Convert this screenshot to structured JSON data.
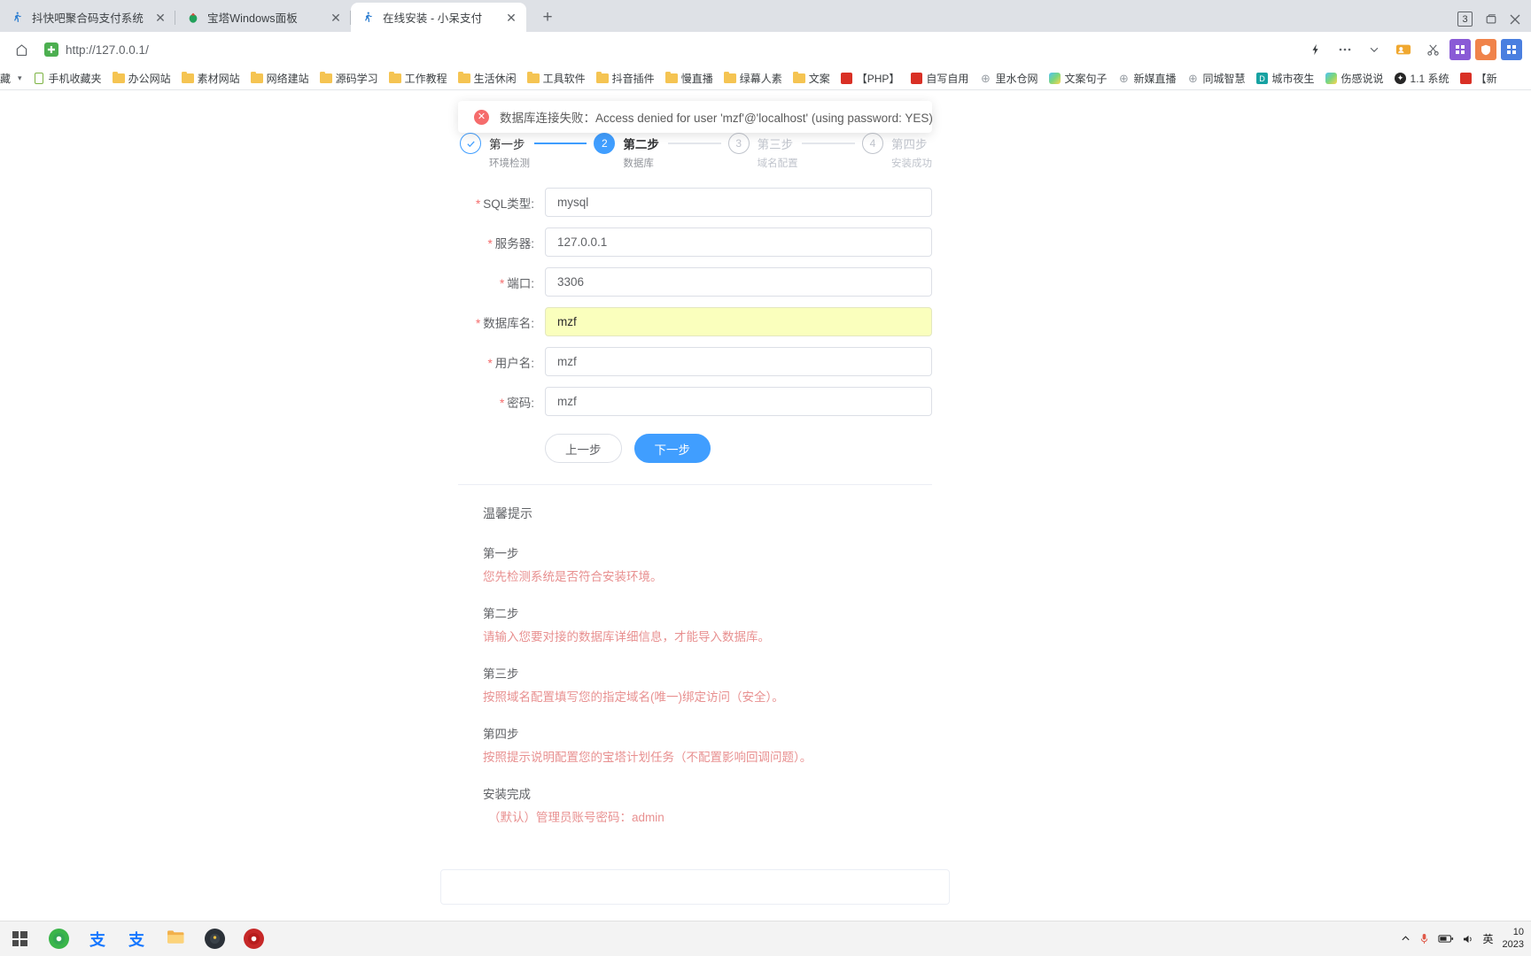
{
  "browser": {
    "tabs": [
      {
        "title": "抖快吧聚合码支付系统",
        "favicon": "runner-icon",
        "active": false
      },
      {
        "title": "宝塔Windows面板",
        "favicon": "bt-panel-icon",
        "active": false
      },
      {
        "title": "在线安装 - 小呆支付",
        "favicon": "runner-icon",
        "active": true
      }
    ],
    "new_tab_label": "+",
    "close_label": "✕",
    "window_controls": {
      "tab_count": "3",
      "restore": "restore-icon",
      "close": "close-icon"
    },
    "toolbar": {
      "home_icon": "home-icon",
      "url": "http://127.0.0.1/",
      "secure_badge": "shield-icon",
      "icons": [
        "lightning-icon",
        "more-horizontal-icon",
        "chevron-down-icon",
        "user-badge-icon",
        "scissors-icon",
        "grid-purple-icon",
        "shield-orange-icon",
        "apps-blue-icon"
      ]
    },
    "bookmarks_overflow_label": "藏",
    "bookmarks": [
      {
        "label": "手机收藏夹",
        "icon": "phone-icon"
      },
      {
        "label": "办公网站",
        "icon": "folder-icon"
      },
      {
        "label": "素材网站",
        "icon": "folder-icon"
      },
      {
        "label": "网络建站",
        "icon": "folder-icon"
      },
      {
        "label": "源码学习",
        "icon": "folder-icon"
      },
      {
        "label": "工作教程",
        "icon": "folder-icon"
      },
      {
        "label": "生活休闲",
        "icon": "folder-icon"
      },
      {
        "label": "工具软件",
        "icon": "folder-icon"
      },
      {
        "label": "抖音插件",
        "icon": "folder-icon"
      },
      {
        "label": "慢直播",
        "icon": "folder-icon"
      },
      {
        "label": "绿幕人素",
        "icon": "folder-icon"
      },
      {
        "label": "文案",
        "icon": "folder-icon"
      },
      {
        "label": "【PHP】",
        "icon": "red-square-icon"
      },
      {
        "label": "自写自用",
        "icon": "red-square-icon"
      },
      {
        "label": "里水仓网",
        "icon": "globe-icon"
      },
      {
        "label": "文案句子",
        "icon": "gradient-icon"
      },
      {
        "label": "新媒直播",
        "icon": "globe-icon"
      },
      {
        "label": "同城智慧",
        "icon": "globe-icon"
      },
      {
        "label": "城市夜生",
        "icon": "teal-square-icon"
      },
      {
        "label": "伤感说说",
        "icon": "gradient-icon"
      },
      {
        "label": "1.1 系统",
        "icon": "black-circle-icon"
      },
      {
        "label": "【新",
        "icon": "red-square-icon"
      }
    ]
  },
  "page": {
    "alert": {
      "icon": "error-circle-icon",
      "message": "数据库连接失败：Access denied for user 'mzf'@'localhost' (using password: YES)"
    },
    "steps": [
      {
        "number": "✓",
        "title": "第一步",
        "sub": "环境检测",
        "state": "done"
      },
      {
        "number": "2",
        "title": "第二步",
        "sub": "数据库",
        "state": "current"
      },
      {
        "number": "3",
        "title": "第三步",
        "sub": "域名配置",
        "state": "todo"
      },
      {
        "number": "4",
        "title": "第四步",
        "sub": "安装成功",
        "state": "todo"
      }
    ],
    "form": {
      "required_mark": "*",
      "fields": [
        {
          "label": "SQL类型:",
          "value": "mysql",
          "autofill": false
        },
        {
          "label": "服务器:",
          "value": "127.0.0.1",
          "autofill": false
        },
        {
          "label": "端口:",
          "value": "3306",
          "autofill": false
        },
        {
          "label": "数据库名:",
          "value": "mzf",
          "autofill": true
        },
        {
          "label": "用户名:",
          "value": "mzf",
          "autofill": false
        },
        {
          "label": "密码:",
          "value": "mzf",
          "autofill": false
        }
      ],
      "prev_button": "上一步",
      "next_button": "下一步"
    },
    "tips": {
      "title": "温馨提示",
      "items": [
        {
          "heading": "第一步",
          "body": "您先检测系统是否符合安装环境。"
        },
        {
          "heading": "第二步",
          "body": "请输入您要对接的数据库详细信息，才能导入数据库。"
        },
        {
          "heading": "第三步",
          "body": "按照域名配置填写您的指定域名(唯一)绑定访问（安全）。"
        },
        {
          "heading": "第四步",
          "body": "按照提示说明配置您的宝塔计划任务（不配置影响回调问题）。"
        },
        {
          "heading": "安装完成",
          "body": "（默认）管理员账号密码：admin"
        }
      ]
    }
  },
  "taskbar": {
    "start_label": "start-icon",
    "apps": [
      {
        "name": "browser-green-icon"
      },
      {
        "name": "alipay-icon-1"
      },
      {
        "name": "alipay-icon-2"
      },
      {
        "name": "file-explorer-icon"
      },
      {
        "name": "app-dark-icon"
      },
      {
        "name": "record-red-icon"
      }
    ],
    "tray": [
      "chevron-up-icon",
      "mic-icon",
      "battery-icon",
      "volume-icon"
    ],
    "ime": "英",
    "clock_time": "10",
    "clock_date": "2023"
  }
}
